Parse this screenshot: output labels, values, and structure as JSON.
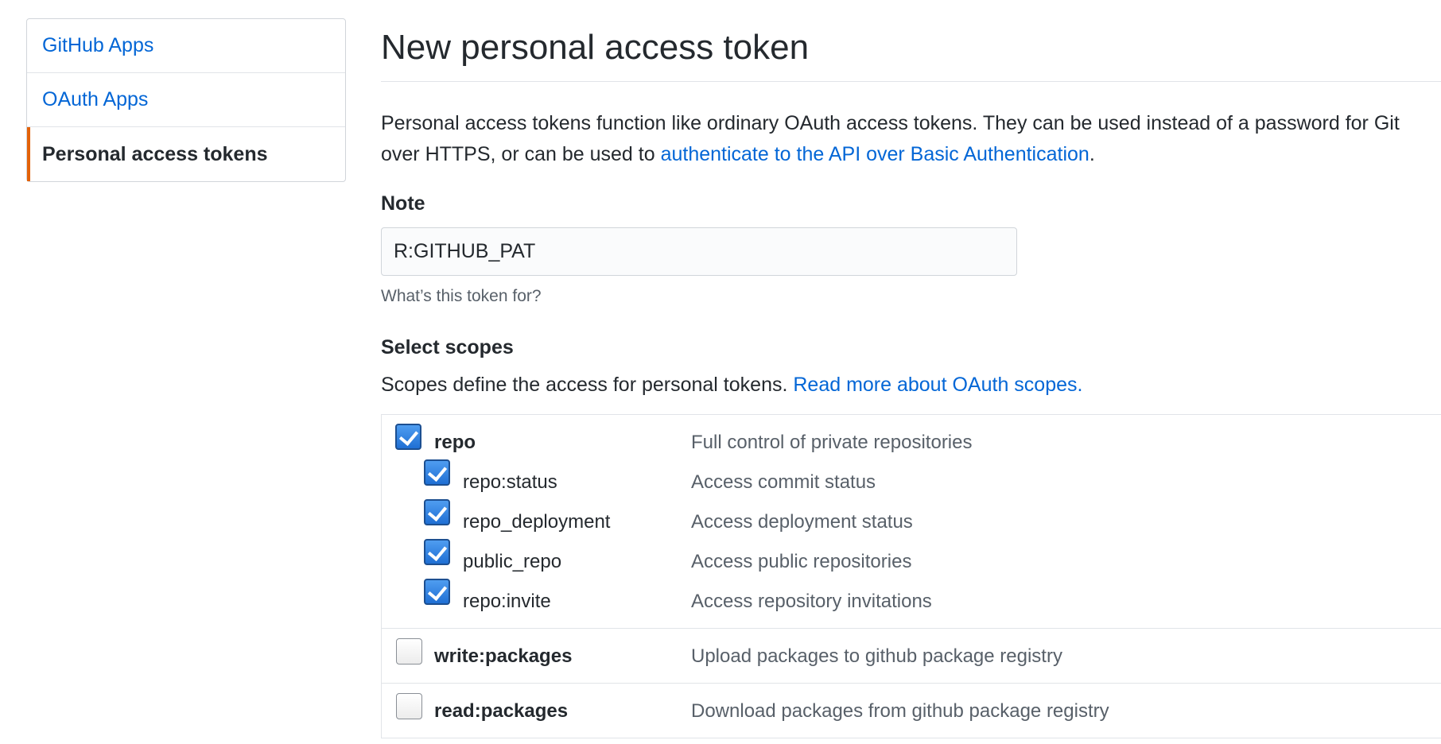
{
  "sidebar": {
    "items": [
      {
        "label": "GitHub Apps",
        "active": false
      },
      {
        "label": "OAuth Apps",
        "active": false
      },
      {
        "label": "Personal access tokens",
        "active": true
      }
    ]
  },
  "main": {
    "title": "New personal access token",
    "intro_text": "Personal access tokens function like ordinary OAuth access tokens. They can be used instead of a password for Git over HTTPS, or can be used to ",
    "intro_link": "authenticate to the API over Basic Authentication",
    "intro_end": ".",
    "note": {
      "label": "Note",
      "value": "R:GITHUB_PAT",
      "hint": "What’s this token for?"
    },
    "scopes": {
      "heading": "Select scopes",
      "desc_text": "Scopes define the access for personal tokens. ",
      "desc_link": "Read more about OAuth scopes.",
      "groups": [
        {
          "name": "repo",
          "desc": "Full control of private repositories",
          "checked": true,
          "children": [
            {
              "name": "repo:status",
              "desc": "Access commit status",
              "checked": true
            },
            {
              "name": "repo_deployment",
              "desc": "Access deployment status",
              "checked": true
            },
            {
              "name": "public_repo",
              "desc": "Access public repositories",
              "checked": true
            },
            {
              "name": "repo:invite",
              "desc": "Access repository invitations",
              "checked": true
            }
          ]
        },
        {
          "name": "write:packages",
          "desc": "Upload packages to github package registry",
          "checked": false,
          "children": []
        },
        {
          "name": "read:packages",
          "desc": "Download packages from github package registry",
          "checked": false,
          "children": []
        }
      ]
    }
  },
  "colors": {
    "link": "#0366d6",
    "active_accent": "#e36209",
    "checkbox_checked": "#1f6fd4"
  }
}
